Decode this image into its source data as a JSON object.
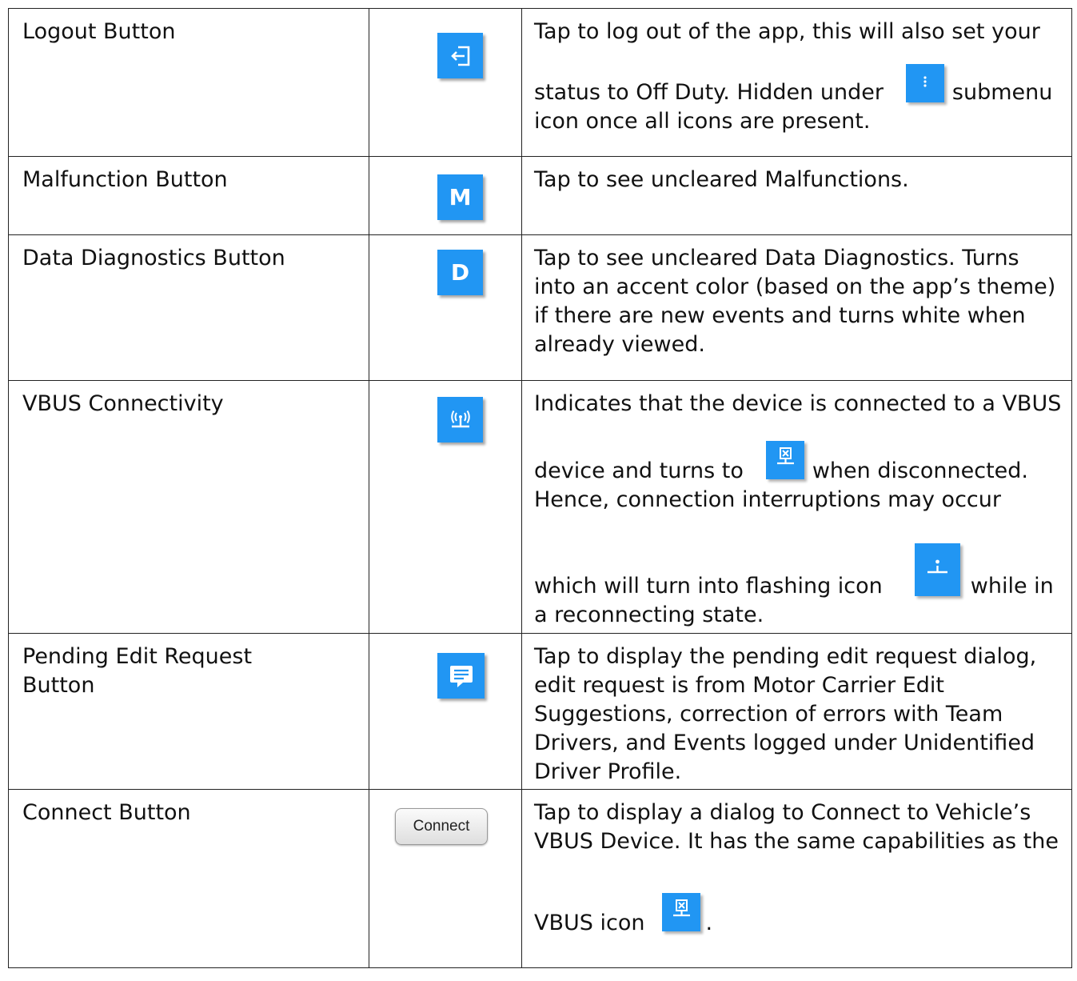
{
  "rows": [
    {
      "name": "Logout Button",
      "icon": "logout-icon",
      "desc_1": "Tap to log out of the app, this will also set your",
      "desc_2a": "status to Off Duty. Hidden under",
      "desc_2b": "submenu",
      "desc_3": "icon once all icons are present.",
      "inline_icon": "submenu-dots-icon"
    },
    {
      "name": "Malfunction Button",
      "icon_letter": "M",
      "desc": "Tap to see uncleared Malfunctions."
    },
    {
      "name": "Data Diagnostics Button",
      "icon_letter": "D",
      "desc_1": "Tap to see uncleared Data Diagnostics. Turns",
      "desc_2": "into an accent color (based on the app’s theme)",
      "desc_3": "if there are new events and turns white when",
      "desc_4": "already viewed."
    },
    {
      "name": "VBUS Connectivity",
      "icon": "vbus-connected-icon",
      "desc_1": "Indicates that the device is connected to a VBUS",
      "desc_2a": "device and turns to",
      "desc_2b": "when disconnected.",
      "desc_3": "Hence, connection interruptions may occur",
      "desc_4a": "which will turn into flashing icon",
      "desc_4b": "while in",
      "desc_5": "a reconnecting state."
    },
    {
      "name_1": "Pending Edit Request",
      "name_2": "Button",
      "icon": "edit-request-icon",
      "desc_1": "Tap to display the pending edit request dialog,",
      "desc_2": "edit request is from Motor Carrier Edit",
      "desc_3": "Suggestions, correction of errors with Team",
      "desc_4": "Drivers, and Events logged under Unidentified",
      "desc_5": "Driver Profile."
    },
    {
      "name": "Connect Button",
      "button_label": "Connect",
      "desc_1": "Tap to display a dialog to Connect to Vehicle’s",
      "desc_2": "VBUS Device. It has the same capabilities as the",
      "desc_3a": "VBUS icon",
      "desc_3b": "."
    }
  ],
  "colors": {
    "icon_blue": "#2196f3",
    "border": "#222222"
  }
}
